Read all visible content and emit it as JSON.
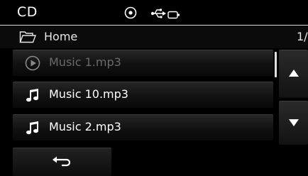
{
  "status": {
    "title": "CD",
    "icons": [
      "disc-icon",
      "usb-icon",
      "battery-icon"
    ]
  },
  "path": {
    "folder_icon": "folder-icon",
    "label": "Home",
    "page": "1/"
  },
  "tracks": [
    {
      "label": "Music 1.mp3",
      "icon": "play-circle-icon",
      "state": "playing"
    },
    {
      "label": "Music 10.mp3",
      "icon": "music-note-icon",
      "state": "normal"
    },
    {
      "label": "Music 2.mp3",
      "icon": "music-note-icon",
      "state": "normal"
    }
  ],
  "scroll": {
    "up_icon": "triangle-up-icon",
    "down_icon": "triangle-down-icon"
  },
  "back": {
    "icon": "back-arrow-icon"
  },
  "colors": {
    "background": "#000000",
    "item_text": "#ffffff",
    "dim_text": "#6a6a6a"
  }
}
